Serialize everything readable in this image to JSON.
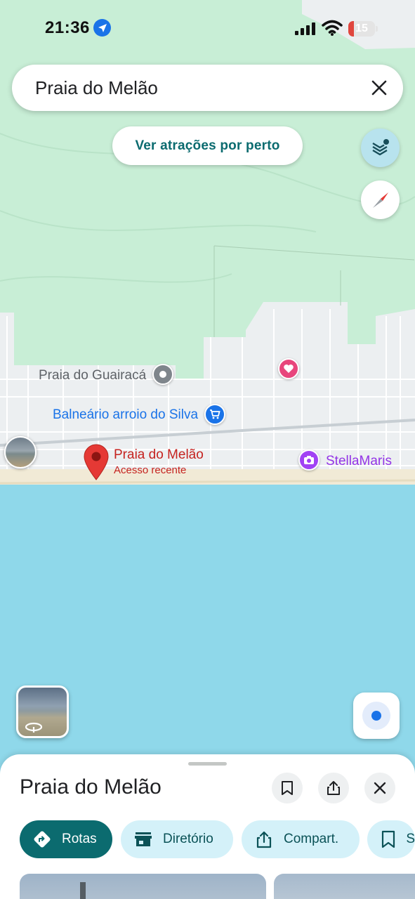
{
  "status_bar": {
    "time": "21:36",
    "battery_percent": "15"
  },
  "search": {
    "query": "Praia do Melão"
  },
  "nearby_chip": {
    "label": "Ver atrações por perto"
  },
  "map": {
    "colors": {
      "water": "#8fd8ea",
      "vegetation": "#c8eed6",
      "urban": "#eceff1",
      "beach": "#f1ead6"
    },
    "labels": {
      "guairaca": "Praia do Guairacá",
      "balneario": "Balneário arroio do Silva",
      "melao": "Praia do Melão",
      "melao_sub": "Acesso recente",
      "stellamaris": "StellaMaris"
    }
  },
  "sheet": {
    "title": "Praia do Melão",
    "actions": [
      {
        "label": "Rotas",
        "icon": "directions-icon"
      },
      {
        "label": "Diretório",
        "icon": "store-icon"
      },
      {
        "label": "Compart.",
        "icon": "share-icon"
      },
      {
        "label": "S",
        "icon": "bookmark-icon"
      }
    ]
  },
  "accent_color": "#0b6b6f"
}
